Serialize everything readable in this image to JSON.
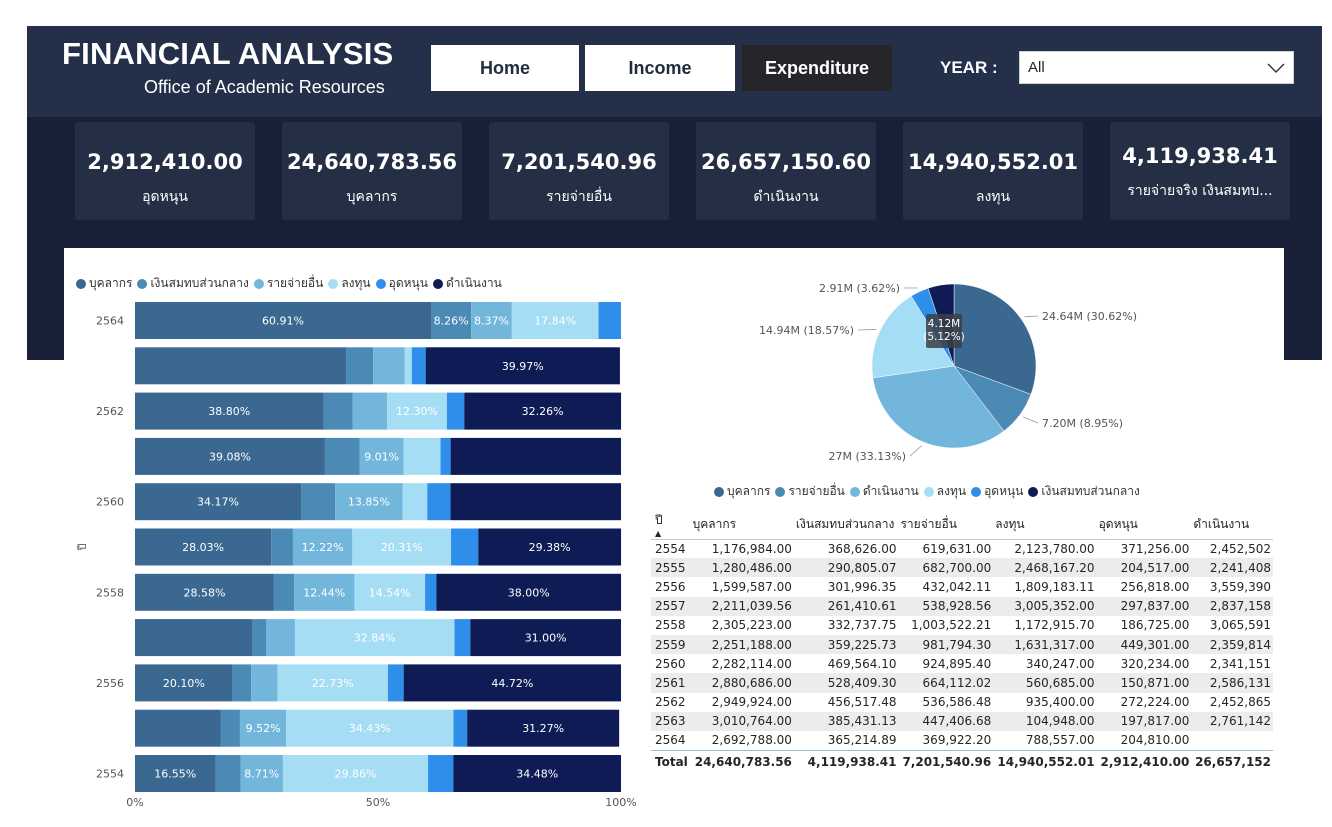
{
  "header": {
    "title": "FINANCIAL ANALYSIS",
    "subtitle": "Office of Academic Resources",
    "nav": {
      "home": "Home",
      "income": "Income",
      "expenditure": "Expenditure"
    },
    "year_label": "YEAR :",
    "year_value": "All"
  },
  "kpis": [
    {
      "value": "2,912,410.00",
      "label": "อุดหนุน"
    },
    {
      "value": "24,640,783.56",
      "label": "บุคลากร"
    },
    {
      "value": "7,201,540.96",
      "label": "รายจ่ายอื่น"
    },
    {
      "value": "26,657,150.60",
      "label": "ดำเนินงาน"
    },
    {
      "value": "14,940,552.01",
      "label": "ลงทุน"
    },
    {
      "value": "4,119,938.41",
      "label": "รายจ่ายจริง เงินสมทบ..."
    }
  ],
  "colors": {
    "personnel": "#3a6891",
    "central": "#4a8ab5",
    "other": "#72b6dc",
    "invest": "#a5ddf5",
    "subsidy": "#2f8eea",
    "operations": "#0e1b54"
  },
  "bar_legend": [
    {
      "label": "บุคลากร",
      "key": "personnel"
    },
    {
      "label": "เงินสมทบส่วนกลาง",
      "key": "central"
    },
    {
      "label": "รายจ่ายอื่น",
      "key": "other"
    },
    {
      "label": "ลงทุน",
      "key": "invest"
    },
    {
      "label": "อุดหนุน",
      "key": "subsidy"
    },
    {
      "label": "ดำเนินงาน",
      "key": "operations"
    }
  ],
  "pie_legend": [
    {
      "label": "บุคลากร",
      "key": "personnel"
    },
    {
      "label": "รายจ่ายอื่น",
      "key": "central"
    },
    {
      "label": "ดำเนินงาน",
      "key": "other"
    },
    {
      "label": "ลงทุน",
      "key": "invest"
    },
    {
      "label": "อุดหนุน",
      "key": "subsidy"
    },
    {
      "label": "เงินสมทบส่วนกลาง",
      "key": "operations"
    }
  ],
  "chart_data": [
    {
      "type": "bar",
      "orientation": "horizontal",
      "stacked": "percent",
      "ylabel": "ปี",
      "categories": [
        "2564",
        "2563",
        "2562",
        "2561",
        "2560",
        "2559",
        "2558",
        "2557",
        "2556",
        "2555",
        "2554"
      ],
      "tick_labels": [
        "2564",
        "",
        "2562",
        "",
        "2560",
        "",
        "2558",
        "",
        "2556",
        "",
        "2554"
      ],
      "x_ticks": [
        "0%",
        "50%",
        "100%"
      ],
      "series_order": [
        "personnel",
        "central",
        "other",
        "invest",
        "subsidy",
        "operations"
      ],
      "segments": [
        [
          60.91,
          8.26,
          8.37,
          17.84,
          4.62,
          0
        ],
        [
          43.43,
          5.56,
          6.46,
          1.51,
          2.85,
          39.97
        ],
        [
          38.8,
          6.01,
          7.06,
          12.3,
          3.58,
          32.26
        ],
        [
          39.08,
          7.17,
          9.01,
          7.61,
          2.07,
          35.06
        ],
        [
          34.17,
          7.03,
          13.85,
          5.09,
          4.79,
          35.07
        ],
        [
          28.03,
          4.47,
          12.22,
          20.31,
          5.6,
          29.38
        ],
        [
          28.58,
          4.13,
          12.44,
          14.54,
          2.32,
          38.0
        ],
        [
          24.16,
          2.86,
          5.89,
          32.84,
          3.25,
          31.0
        ],
        [
          20.1,
          3.79,
          5.42,
          22.73,
          3.24,
          44.72
        ],
        [
          17.59,
          4.0,
          9.52,
          34.43,
          2.81,
          31.27
        ],
        [
          16.55,
          5.18,
          8.71,
          29.86,
          5.22,
          34.48
        ]
      ],
      "labels": [
        [
          "60.91%",
          "8.26%",
          "8.37%",
          "17.84%",
          "",
          ""
        ],
        [
          "",
          "",
          "",
          "",
          "",
          "39.97%"
        ],
        [
          "38.80%",
          "",
          "",
          "12.30%",
          "",
          "32.26%"
        ],
        [
          "39.08%",
          "",
          "9.01%",
          "",
          "",
          ""
        ],
        [
          "34.17%",
          "",
          "13.85%",
          "",
          "",
          ""
        ],
        [
          "28.03%",
          "",
          "12.22%",
          "20.31%",
          "",
          "29.38%"
        ],
        [
          "28.58%",
          "",
          "12.44%",
          "14.54%",
          "",
          "38.00%"
        ],
        [
          "",
          "",
          "",
          "32.84%",
          "",
          "31.00%"
        ],
        [
          "20.10%",
          "",
          "",
          "22.73%",
          "",
          "44.72%"
        ],
        [
          "",
          "",
          "9.52%",
          "34.43%",
          "",
          "31.27%"
        ],
        [
          "16.55%",
          "",
          "8.71%",
          "29.86%",
          "",
          "34.48%"
        ]
      ]
    },
    {
      "type": "pie",
      "slices": [
        {
          "key": "personnel",
          "value": 24.64,
          "percent": 30.62,
          "label": "24.64M (30.62%)"
        },
        {
          "key": "central",
          "value": 7.2,
          "percent": 8.95,
          "label": "7.20M (8.95%)"
        },
        {
          "key": "other",
          "value": 27.0,
          "percent": 33.13,
          "label": "27M (33.13%)"
        },
        {
          "key": "invest",
          "value": 14.94,
          "percent": 18.57,
          "label": "14.94M (18.57%)"
        },
        {
          "key": "subsidy",
          "value": 2.91,
          "percent": 3.62,
          "label": "2.91M (3.62%)"
        },
        {
          "key": "operations",
          "value": 4.12,
          "percent": 5.12,
          "label": "4.12M (5.12%)"
        }
      ],
      "tooltip": [
        "4.12M",
        "(5.12%)"
      ]
    },
    {
      "type": "table",
      "columns": [
        "ปี",
        "บุคลากร",
        "เงินสมทบส่วนกลาง",
        "รายจ่ายอื่น",
        "ลงทุน",
        "อุดหนุน",
        "ดำเนินงาน"
      ],
      "rows": [
        [
          "2554",
          "1,176,984.00",
          "368,626.00",
          "619,631.00",
          "2,123,780.00",
          "371,256.00",
          "2,452,502"
        ],
        [
          "2555",
          "1,280,486.00",
          "290,805.07",
          "682,700.00",
          "2,468,167.20",
          "204,517.00",
          "2,241,408"
        ],
        [
          "2556",
          "1,599,587.00",
          "301,996.35",
          "432,042.11",
          "1,809,183.11",
          "256,818.00",
          "3,559,390"
        ],
        [
          "2557",
          "2,211,039.56",
          "261,410.61",
          "538,928.56",
          "3,005,352.00",
          "297,837.00",
          "2,837,158"
        ],
        [
          "2558",
          "2,305,223.00",
          "332,737.75",
          "1,003,522.21",
          "1,172,915.70",
          "186,725.00",
          "3,065,591"
        ],
        [
          "2559",
          "2,251,188.00",
          "359,225.73",
          "981,794.30",
          "1,631,317.00",
          "449,301.00",
          "2,359,814"
        ],
        [
          "2560",
          "2,282,114.00",
          "469,564.10",
          "924,895.40",
          "340,247.00",
          "320,234.00",
          "2,341,151"
        ],
        [
          "2561",
          "2,880,686.00",
          "528,409.30",
          "664,112.02",
          "560,685.00",
          "150,871.00",
          "2,586,131"
        ],
        [
          "2562",
          "2,949,924.00",
          "456,517.48",
          "536,586.48",
          "935,400.00",
          "272,224.00",
          "2,452,865"
        ],
        [
          "2563",
          "3,010,764.00",
          "385,431.13",
          "447,406.68",
          "104,948.00",
          "197,817.00",
          "2,761,142"
        ],
        [
          "2564",
          "2,692,788.00",
          "365,214.89",
          "369,922.20",
          "788,557.00",
          "204,810.00",
          ""
        ]
      ],
      "total": [
        "Total",
        "24,640,783.56",
        "4,119,938.41",
        "7,201,540.96",
        "14,940,552.01",
        "2,912,410.00",
        "26,657,152"
      ]
    }
  ]
}
